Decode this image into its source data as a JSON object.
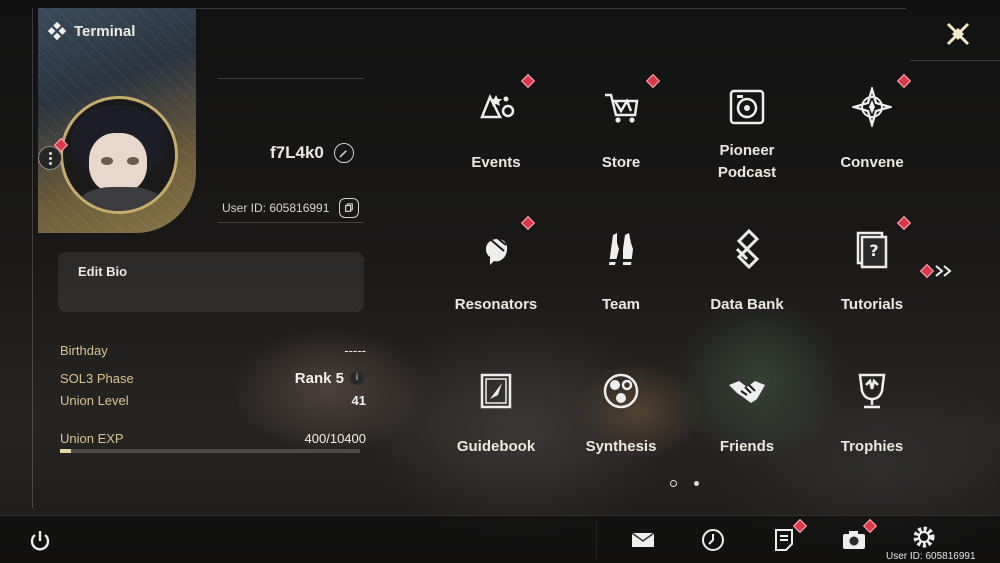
{
  "header": {
    "title": "Terminal"
  },
  "profile": {
    "name": "f7L4k0",
    "user_id": "User ID: 605816991",
    "edit_bio_label": "Edit Bio",
    "stats": [
      {
        "label": "Birthday",
        "value": "-----"
      },
      {
        "label": "SOL3 Phase",
        "value": "Rank 5"
      },
      {
        "label": "Union Level",
        "value": "41"
      }
    ],
    "union_exp": {
      "label": "Union EXP",
      "value": "400/10400",
      "fraction": 0.038
    }
  },
  "menu": [
    {
      "label": "Events",
      "icon": "events-icon",
      "badge": true
    },
    {
      "label": "Store",
      "icon": "store-cart-icon",
      "badge": true
    },
    {
      "label": "Pioneer Podcast",
      "icon": "podcast-icon",
      "badge": false
    },
    {
      "label": "Convene",
      "icon": "convene-icon",
      "badge": true
    },
    {
      "label": "Resonators",
      "icon": "resonators-icon",
      "badge": true
    },
    {
      "label": "Team",
      "icon": "team-icon",
      "badge": false
    },
    {
      "label": "Data Bank",
      "icon": "data-bank-icon",
      "badge": false
    },
    {
      "label": "Tutorials",
      "icon": "tutorials-icon",
      "badge": true
    },
    {
      "label": "Guidebook",
      "icon": "guidebook-icon",
      "badge": false
    },
    {
      "label": "Synthesis",
      "icon": "synthesis-icon",
      "badge": false
    },
    {
      "label": "Friends",
      "icon": "friends-icon",
      "badge": false
    },
    {
      "label": "Trophies",
      "icon": "trophies-icon",
      "badge": false
    }
  ],
  "pagination": {
    "pages": 2,
    "current": 1
  },
  "bottom_bar": {
    "buttons": [
      "power-icon",
      "mail-icon",
      "clock-icon",
      "notes-icon",
      "camera-icon",
      "settings-gear-icon"
    ],
    "user_id": "User ID: 605816991"
  },
  "colors": {
    "accent_gold": "#d8c48e",
    "badge_red": "#d93a4a"
  }
}
